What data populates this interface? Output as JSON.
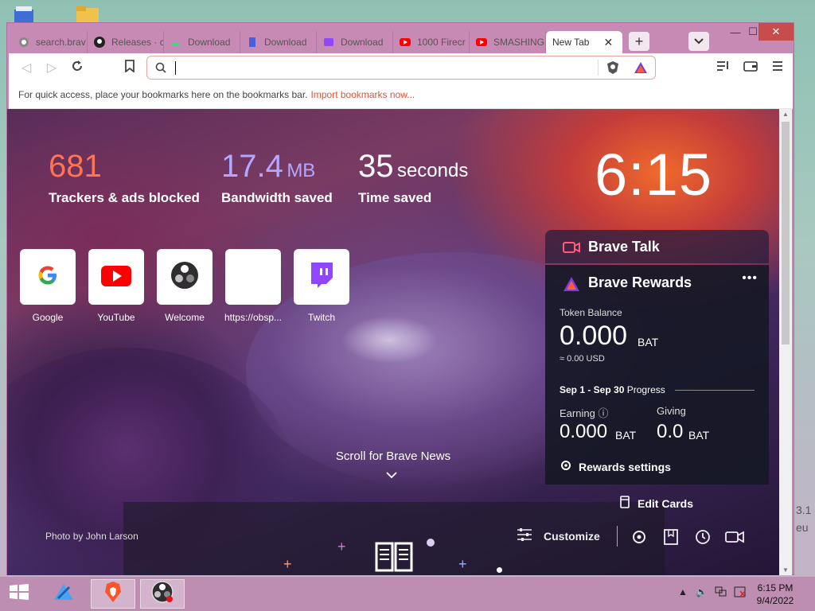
{
  "tabs": [
    {
      "label": "search.brav",
      "icon": "brave-search-icon"
    },
    {
      "label": "Releases · c",
      "icon": "github-icon"
    },
    {
      "label": "Download",
      "icon": "android-icon"
    },
    {
      "label": "Download",
      "icon": "document-icon"
    },
    {
      "label": "Download",
      "icon": "twitch-icon"
    },
    {
      "label": "1000 Firecr",
      "icon": "youtube-icon"
    },
    {
      "label": "SMASHING",
      "icon": "youtube-icon"
    },
    {
      "label": "New Tab",
      "icon": "none",
      "active": true
    }
  ],
  "toolbar": {
    "new_tab": "+",
    "address_value": ""
  },
  "bookmarks_bar": {
    "text": "For quick access, place your bookmarks here on the bookmarks bar.",
    "link": "Import bookmarks now..."
  },
  "stats": {
    "trackers_value": "681",
    "trackers_label": "Trackers & ads blocked",
    "bandwidth_value": "17.4",
    "bandwidth_unit": "MB",
    "bandwidth_label": "Bandwidth saved",
    "time_value": "35",
    "time_unit": "seconds",
    "time_label": "Time saved"
  },
  "clock": "6:15",
  "top_sites": [
    {
      "label": "Google",
      "icon": "google-icon"
    },
    {
      "label": "YouTube",
      "icon": "youtube-icon"
    },
    {
      "label": "Welcome",
      "icon": "obs-icon"
    },
    {
      "label": "https://obsp...",
      "icon": "blank-icon"
    },
    {
      "label": "Twitch",
      "icon": "twitch-icon"
    }
  ],
  "brave_talk": {
    "title": "Brave Talk"
  },
  "rewards": {
    "title": "Brave Rewards",
    "token_balance_label": "Token Balance",
    "token_balance_value": "0.000",
    "token_balance_unit": "BAT",
    "token_balance_usd": "≈ 0.00 USD",
    "period_dates": "Sep 1 - Sep 30",
    "period_suffix": "Progress",
    "earning_label": "Earning",
    "earning_value": "0.000",
    "earning_unit": "BAT",
    "giving_label": "Giving",
    "giving_value": "0.0",
    "giving_unit": "BAT",
    "settings_label": "Rewards settings"
  },
  "edit_cards": "Edit Cards",
  "scroll_news": "Scroll for Brave News",
  "photo_credit_prefix": "Photo by",
  "photo_credit_name": "John Larson",
  "customize": "Customize",
  "taskbar": {
    "time": "6:15 PM",
    "date": "9/4/2022"
  },
  "side_text": [
    "3.1",
    "eu"
  ],
  "colors": {
    "accent": "#ff7452",
    "bandwidth": "#b4a7ff",
    "window_frame": "#c78ab5",
    "taskbar": "#bd8db2"
  }
}
